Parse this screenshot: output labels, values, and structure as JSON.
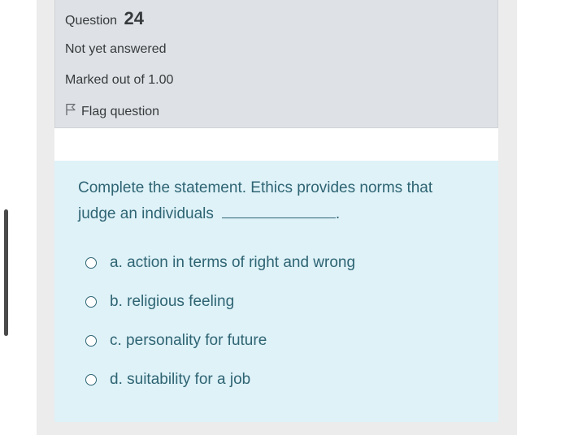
{
  "question": {
    "label": "Question",
    "number": "24",
    "state": "Not yet answered",
    "grade": "Marked out of 1.00",
    "flag_label": "Flag question"
  },
  "prompt": {
    "text": "Complete the statement. Ethics provides norms that judge an individuals",
    "after_blank": "."
  },
  "options": [
    {
      "label": "a. action in terms of right and wrong"
    },
    {
      "label": "b. religious feeling"
    },
    {
      "label": "c. personality for future"
    },
    {
      "label": "d. suitability for a job"
    }
  ],
  "icons": {
    "flag": "flag-icon",
    "radio": "radio-icon"
  },
  "colors": {
    "info_bg": "#dee2e6",
    "content_bg": "#def2f8",
    "content_text": "#2f6473",
    "info_text": "#373a3c"
  }
}
